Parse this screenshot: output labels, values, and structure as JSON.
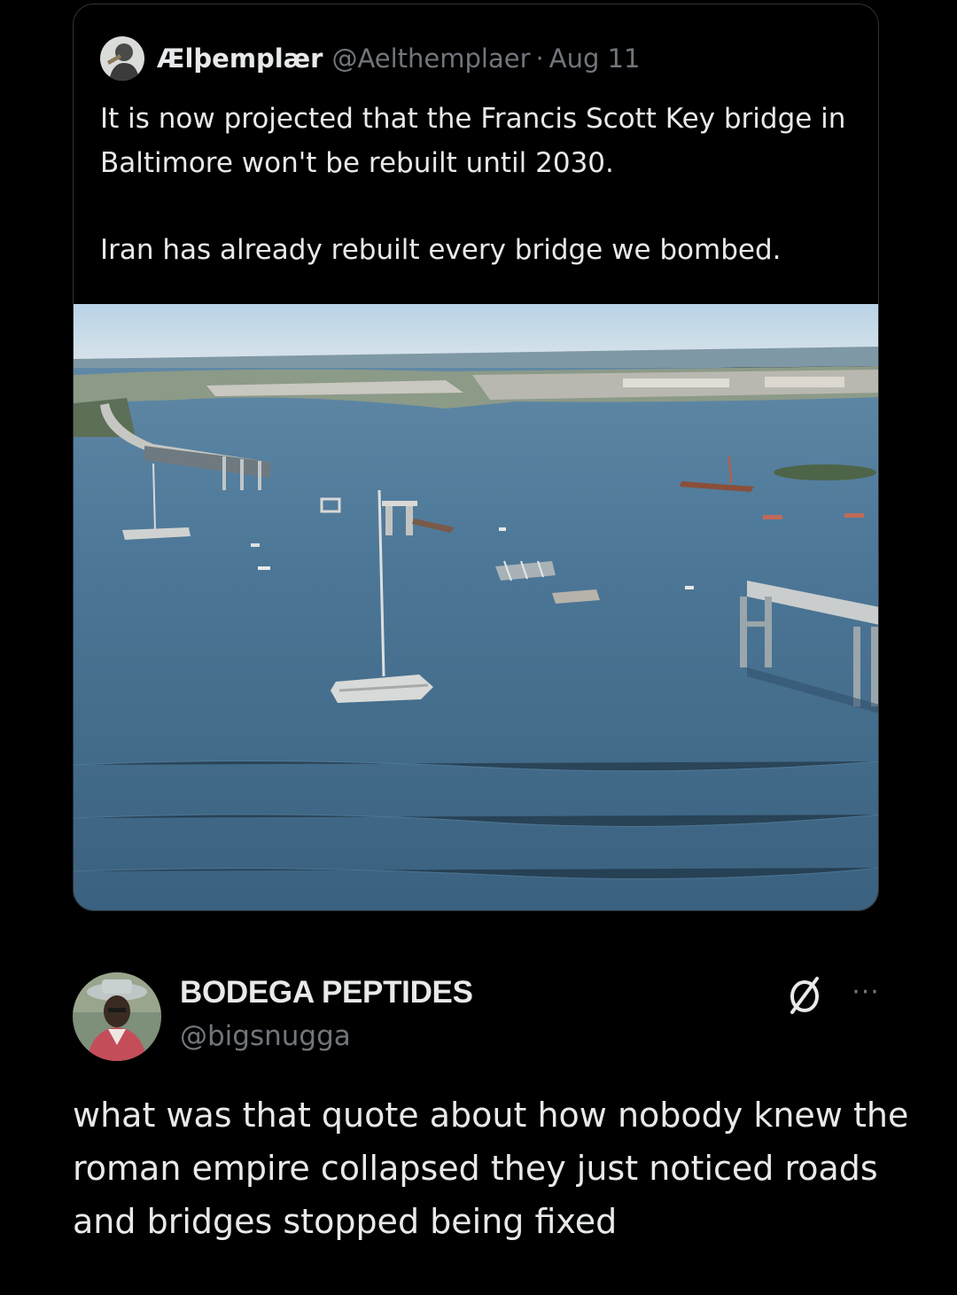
{
  "quoted_tweet": {
    "author_name": "Ælþemplær",
    "author_handle": "@Aelthemplaer",
    "separator": "·",
    "date": "Aug 11",
    "text_paragraph_1": "It is now projected that the Francis Scott Key bridge in Baltimore won't be rebuilt until 2030.",
    "text_paragraph_2": "Iran has already rebuilt every bridge we bombed.",
    "media_icon": "aerial-photo-collapsed-bridge"
  },
  "reply": {
    "author_name": "BODEGA PEPTIDES",
    "author_handle": "@bigsnugga",
    "badge_icon": "null-set-icon",
    "more_label": "···",
    "text": "what was that quote about how nobody knew the roman empire collapsed they just noticed roads and bridges stopped being fixed"
  },
  "colors": {
    "background": "#000000",
    "text_primary": "#e7e9ea",
    "text_secondary": "#71767b",
    "border": "#2f3336",
    "water": "#3f6a8a"
  }
}
